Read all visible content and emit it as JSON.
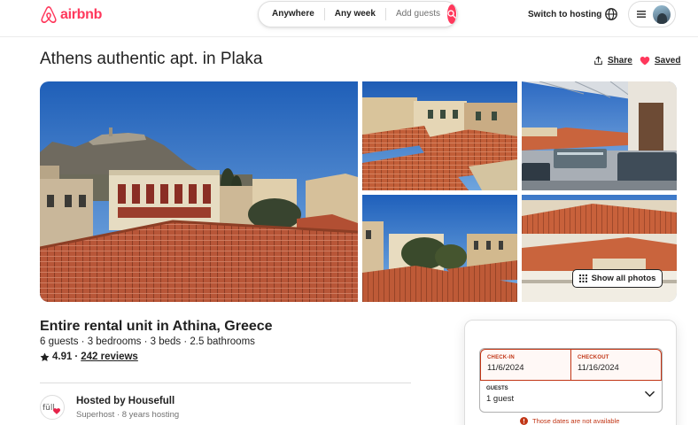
{
  "brand": {
    "name": "airbnb",
    "color": "#ff385c"
  },
  "search": {
    "location": "Anywhere",
    "dates": "Any week",
    "guests_placeholder": "Add guests"
  },
  "nav": {
    "switch_hosting": "Switch to hosting"
  },
  "listing": {
    "title": "Athens authentic apt. in Plaka",
    "share_label": "Share",
    "saved_label": "Saved",
    "show_all_photos": "Show all photos",
    "subtitle": "Entire rental unit in Athina, Greece",
    "details": "6 guests · 3 bedrooms · 3 beds · 2.5 bathrooms",
    "rating": "4.91",
    "separator": "·",
    "reviews": "242 reviews"
  },
  "host": {
    "hosted_by": "Hosted by Housefull",
    "meta": "Superhost · 8 years hosting",
    "logo_text": "füll"
  },
  "booking": {
    "checkin_label": "CHECK-IN",
    "checkin_value": "11/6/2024",
    "checkout_label": "CHECKOUT",
    "checkout_value": "11/16/2024",
    "guests_label": "GUESTS",
    "guests_value": "1 guest",
    "error_message": "Those dates are not available",
    "error_color": "#c13515"
  }
}
